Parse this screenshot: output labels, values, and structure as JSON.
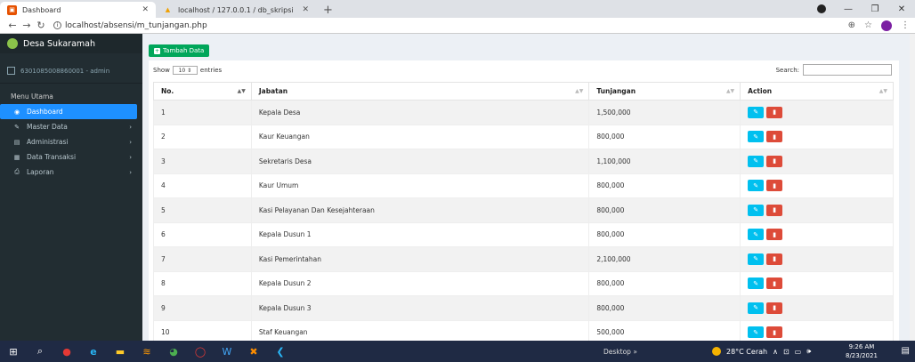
{
  "browser": {
    "tabs": [
      {
        "title": "Dashboard"
      },
      {
        "title": "localhost / 127.0.0.1 / db_skripsi"
      }
    ],
    "url": "localhost/absensi/m_tunjangan.php"
  },
  "sidebar": {
    "brand": "Desa Sukaramah",
    "user": "6301085008860001 - admin",
    "menu_header": "Menu Utama",
    "items": [
      {
        "label": "Dashboard",
        "icon": "dashboard-icon"
      },
      {
        "label": "Master Data",
        "icon": "edit-icon"
      },
      {
        "label": "Administrasi",
        "icon": "book-icon"
      },
      {
        "label": "Data Transaksi",
        "icon": "table-icon"
      },
      {
        "label": "Laporan",
        "icon": "print-icon"
      }
    ]
  },
  "main": {
    "add_button": "Tambah Data",
    "show_label": "Show",
    "show_value": "10",
    "entries_label": "entries",
    "search_label": "Search:",
    "columns": [
      "No.",
      "Jabatan",
      "Tunjangan",
      "Action"
    ],
    "rows": [
      {
        "no": "1",
        "jabatan": "Kepala Desa",
        "tunjangan": "1,500,000"
      },
      {
        "no": "2",
        "jabatan": "Kaur Keuangan",
        "tunjangan": "800,000"
      },
      {
        "no": "3",
        "jabatan": "Sekretaris Desa",
        "tunjangan": "1,100,000"
      },
      {
        "no": "4",
        "jabatan": "Kaur Umum",
        "tunjangan": "800,000"
      },
      {
        "no": "5",
        "jabatan": "Kasi Pelayanan Dan Kesejahteraan",
        "tunjangan": "800,000"
      },
      {
        "no": "6",
        "jabatan": "Kepala Dusun 1",
        "tunjangan": "800,000"
      },
      {
        "no": "7",
        "jabatan": "Kasi Pemerintahan",
        "tunjangan": "2,100,000"
      },
      {
        "no": "8",
        "jabatan": "Kepala Dusun 2",
        "tunjangan": "800,000"
      },
      {
        "no": "9",
        "jabatan": "Kepala Dusun 3",
        "tunjangan": "800,000"
      },
      {
        "no": "10",
        "jabatan": "Staf Keuangan",
        "tunjangan": "500,000"
      }
    ]
  },
  "taskbar": {
    "desktop_label": "Desktop",
    "weather": "28°C  Cerah",
    "time": "9:26 AM",
    "date": "8/23/2021"
  },
  "colors": {
    "sidebar_bg": "#222d32",
    "active_menu": "#1e90ff",
    "add_button": "#00a65a",
    "edit_button": "#00c0ef",
    "delete_button": "#dd4b39"
  }
}
